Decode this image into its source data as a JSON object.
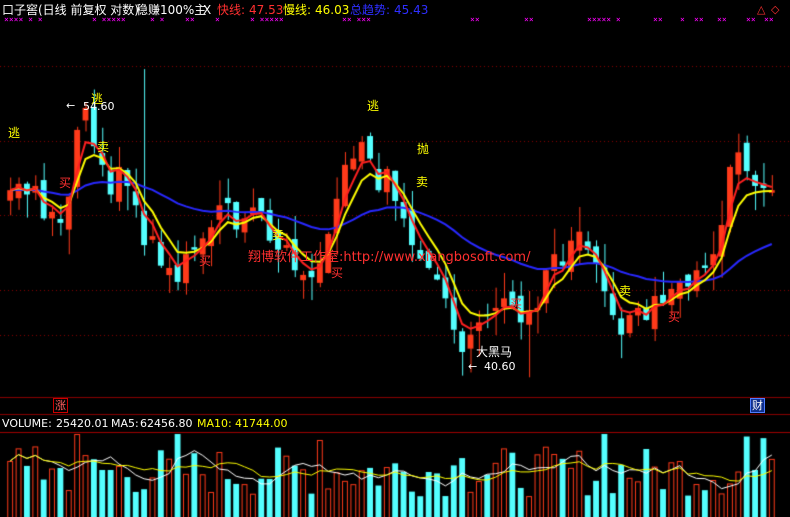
{
  "header": {
    "title": "口子窖(日线 前复权 对数)",
    "indicator_name": "稳赚100%主",
    "close_mark": "X",
    "fast_label": "快线:",
    "fast_value": "47.53",
    "slow_label": "慢线:",
    "slow_value": "46.03",
    "trend_label": "总趋势:",
    "trend_value": "45.43"
  },
  "x_marks": [
    "×××× × ×",
    "× ×××××",
    "× ×",
    "××",
    "×",
    "× ×××××",
    "×× ×××",
    "××",
    "××",
    "××××× ×",
    "××",
    "×",
    "××",
    "××",
    "××",
    "××"
  ],
  "watermark": "翔博软件工作室:http://www.xiangbosoft.com/",
  "signals": [
    {
      "text": "逃",
      "color": "#ffff00"
    },
    {
      "text": "逃",
      "color": "#ffff00"
    },
    {
      "text": "逃",
      "color": "#ffff00"
    },
    {
      "text": "抛",
      "color": "#ffff00"
    },
    {
      "text": "卖",
      "color": "#ffff00"
    },
    {
      "text": "卖",
      "color": "#ffff00"
    },
    {
      "text": "卖",
      "color": "#ffff00"
    },
    {
      "text": "卖",
      "color": "#ffff00"
    },
    {
      "text": "买",
      "color": "#ff3030"
    },
    {
      "text": "买",
      "color": "#ff3030"
    },
    {
      "text": "买",
      "color": "#ff3030"
    },
    {
      "text": "买",
      "color": "#ff3030"
    },
    {
      "text": "买",
      "color": "#ff3030"
    },
    {
      "text": "大黑马",
      "color": "#ffffff"
    }
  ],
  "price_marks": {
    "high": "54.60",
    "low": "40.60"
  },
  "badges": {
    "left": "涨",
    "right": "财"
  },
  "volume": {
    "label": "VOLUME:",
    "value": "25420.01",
    "ma5_label": "MA5:",
    "ma5_value": "62456.80",
    "ma10_label": "MA10:",
    "ma10_value": "41744.00"
  },
  "colors": {
    "up": "#ff3a1a",
    "down": "#54ffff",
    "fast": "#ff2020",
    "slow": "#ffff00",
    "trend": "#2828ff",
    "grid": "#8b0000",
    "watermark": "#ff3030"
  },
  "chart_data": {
    "type": "candlestick",
    "scale": "log",
    "series": [
      {
        "name": "快线",
        "last": 47.53
      },
      {
        "name": "慢线",
        "last": 46.03
      },
      {
        "name": "总趋势",
        "last": 45.43
      }
    ],
    "close": [
      48.6,
      48.9,
      48.4,
      48.8,
      47.3,
      47.6,
      47.1,
      48.3,
      51.5,
      52.6,
      50.7,
      49.8,
      48.4,
      49.7,
      48.8,
      47.9,
      46.1,
      46.5,
      45.2,
      45.1,
      44.5,
      45.7,
      45.9,
      46.4,
      46.9,
      47.9,
      48.0,
      46.8,
      47.3,
      47.8,
      47.6,
      46.3,
      45.9,
      46.1,
      45.0,
      44.8,
      44.7,
      45.3,
      46.6,
      48.2,
      49.8,
      50.1,
      50.9,
      50.1,
      48.6,
      49.6,
      48.1,
      47.3,
      46.1,
      45.5,
      45.1,
      44.6,
      43.8,
      42.5,
      41.6,
      42.3,
      42.8,
      43.1,
      43.4,
      43.8,
      43.5,
      42.8,
      43.3,
      43.4,
      45.0,
      45.7,
      45.2,
      46.3,
      46.7,
      45.9,
      45.3,
      44.1,
      43.1,
      42.3,
      43.1,
      43.4,
      42.9,
      43.9,
      43.6,
      44.2,
      44.5,
      44.3,
      45.0,
      45.1,
      45.7,
      47.0,
      49.7,
      50.4,
      49.5,
      48.8,
      48.7,
      48.6
    ],
    "volume": [
      25420.01,
      62456.8,
      41744.0
    ]
  }
}
